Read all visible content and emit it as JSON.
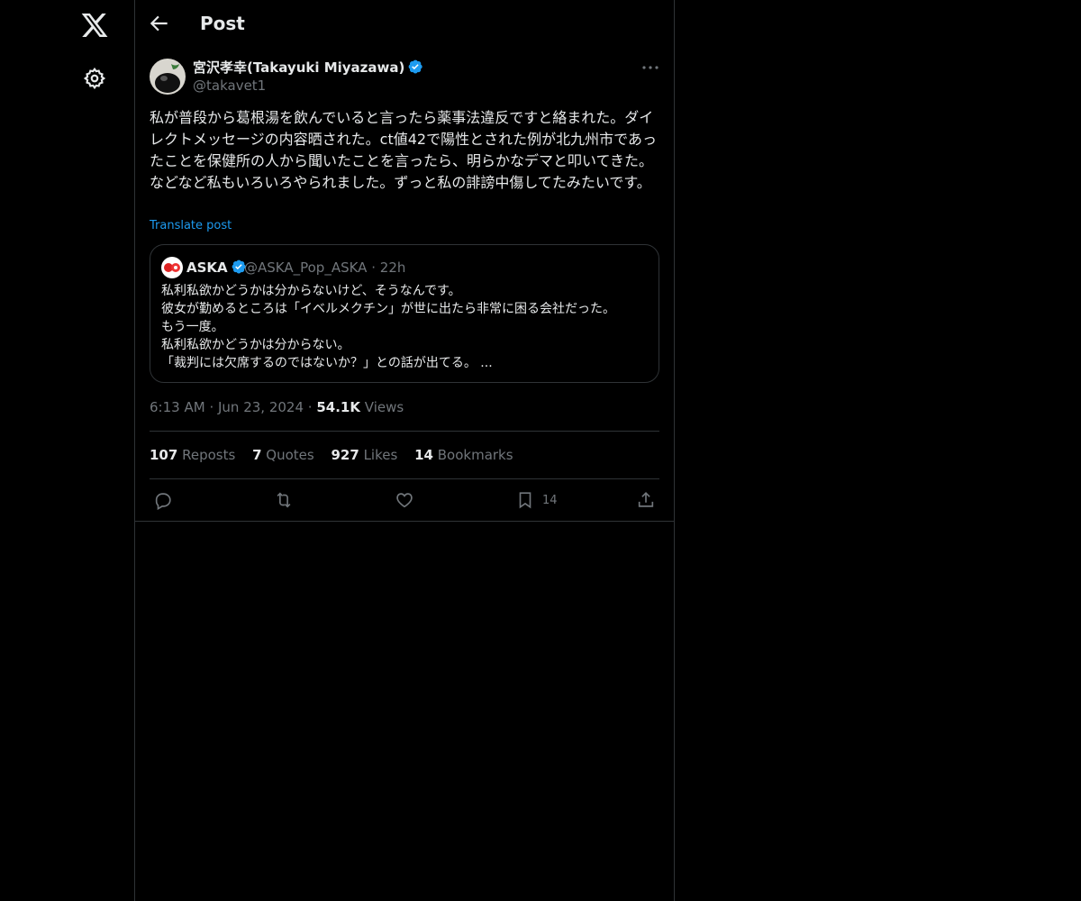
{
  "header": {
    "title": "Post"
  },
  "post": {
    "author_name": "宮沢孝幸(Takayuki Miyazawa)",
    "author_handle": "@takavet1",
    "text": "私が普段から葛根湯を飲んでいると言ったら薬事法違反ですと絡まれた。ダイレクトメッセージの内容晒された。ct値42で陽性とされた例が北九州市であったことを保健所の人から聞いたことを言ったら、明らかなデマと叩いてきた。などなど私もいろいろやられました。ずっと私の誹謗中傷してたみたいです。",
    "translate_label": "Translate post",
    "time": "6:13 AM",
    "date": "Jun 23, 2024",
    "views_count": "54.1K",
    "views_label": "Views",
    "sep": "·"
  },
  "quote": {
    "name": "ASKA",
    "handle": "@ASKA_Pop_ASKA",
    "sep": "·",
    "time": "22h",
    "text": "私利私欲かどうかは分からないけど、そうなんです。\n彼女が勤めるところは「イベルメクチン」が世に出たら非常に困る会社だった。\nもう一度。\n私利私欲かどうかは分からない。\n「裁判には欠席するのではないか？」との話が出てる。 ..."
  },
  "stats": {
    "reposts_count": "107",
    "reposts_label": "Reposts",
    "quotes_count": "7",
    "quotes_label": "Quotes",
    "likes_count": "927",
    "likes_label": "Likes",
    "bookmarks_count": "14",
    "bookmarks_label": "Bookmarks"
  },
  "actions": {
    "bookmark_count": "14"
  },
  "icons": [
    "x-logo-icon",
    "gear-icon",
    "back-arrow-icon",
    "verified-badge-icon",
    "more-icon",
    "reply-icon",
    "repost-icon",
    "like-icon",
    "bookmark-icon",
    "share-icon"
  ],
  "colors": {
    "background": "#000000",
    "text": "#e7e9ea",
    "muted": "#71767b",
    "accent": "#1d9bf0",
    "border": "#2f3336"
  }
}
